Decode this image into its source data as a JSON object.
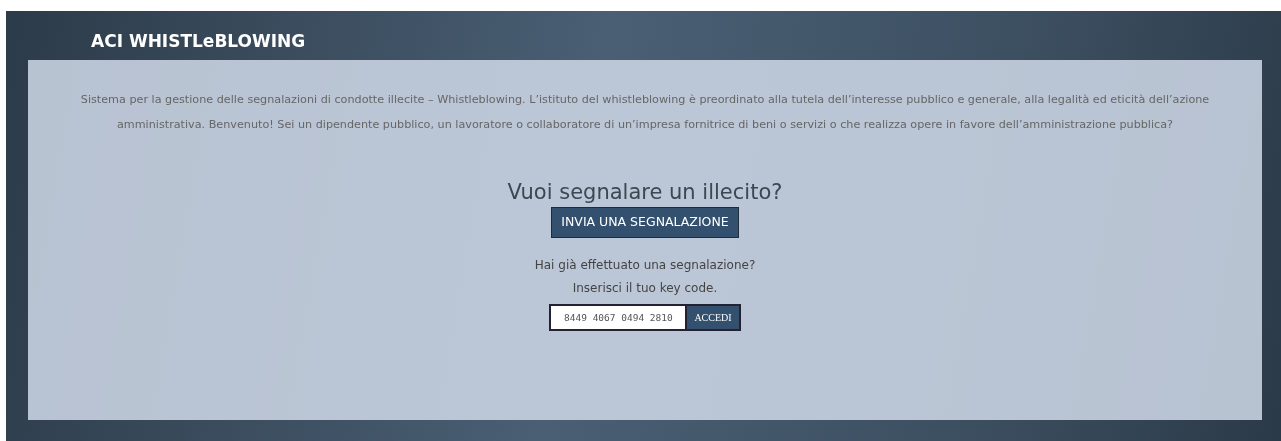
{
  "header": {
    "title": "ACI WHISTLeBLOWING"
  },
  "intro": "Sistema per la gestione delle segnalazioni di condotte illecite – Whistleblowing. L’istituto del whistleblowing è preordinato alla tutela dell’interesse pubblico e generale, alla legalità ed eticità dell’azione amministrativa. Benvenuto! Sei un dipendente pubblico, un lavoratore o collaboratore di un’impresa fornitrice di beni o servizi o che realizza opere in favore dell’amministrazione pubblica?",
  "report": {
    "heading": "Vuoi segnalare un illecito?",
    "button": "INVIA UNA SEGNALAZIONE"
  },
  "access": {
    "question": "Hai già effettuato una segnalazione?",
    "instruction": "Inserisci il tuo key code.",
    "placeholder": "8449 4067 0494 2810",
    "button": "ACCEDI"
  }
}
